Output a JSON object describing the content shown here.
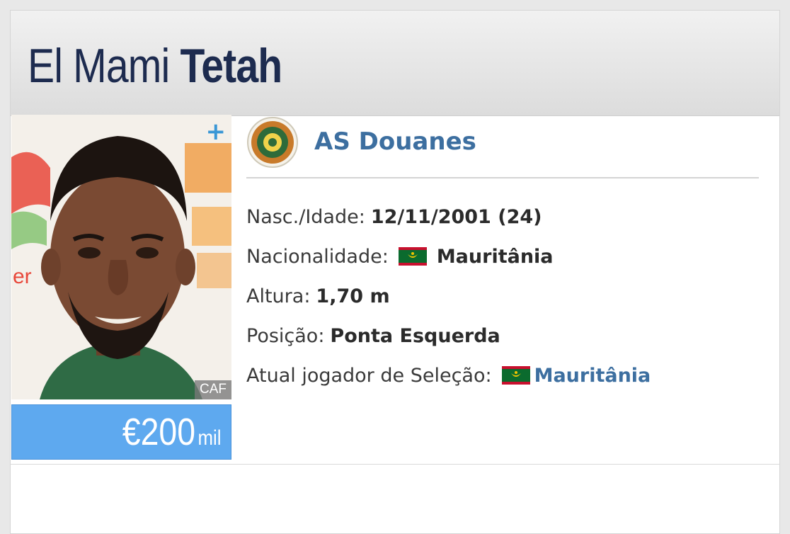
{
  "player": {
    "first_name": "El Mami",
    "last_name": "Tetah"
  },
  "photo": {
    "add_icon": "+",
    "credit": "CAF"
  },
  "market_value": {
    "amount": "€200",
    "unit": "mil"
  },
  "club": {
    "name": "AS Douanes",
    "logo_icon": "club-crest-icon"
  },
  "info": {
    "birth": {
      "label": "Nasc./Idade:",
      "value": "12/11/2001 (24)"
    },
    "nationality": {
      "label": "Nacionalidade:",
      "value": "Mauritânia",
      "flag_icon": "mauritania-flag-icon"
    },
    "height": {
      "label": "Altura:",
      "value": "1,70 m"
    },
    "position": {
      "label": "Posição:",
      "value": "Ponta Esquerda"
    },
    "national_team": {
      "label": "Atual jogador de Seleção:",
      "value": "Mauritânia",
      "flag_icon": "mauritania-flag-icon"
    }
  },
  "colors": {
    "name_color": "#1d2b4f",
    "link_color": "#3d6fa0",
    "market_value_bg": "#5ea9ef",
    "plus_color": "#3a97d6"
  }
}
